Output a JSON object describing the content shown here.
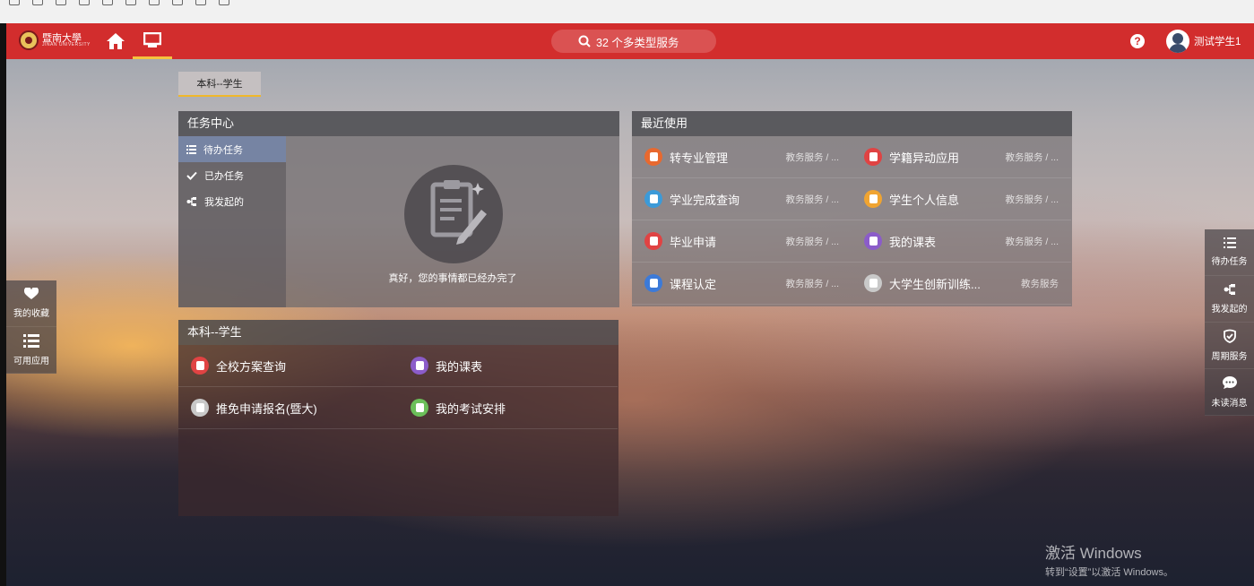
{
  "browser": {
    "bookmarks": [
      "",
      "",
      "",
      "",
      "",
      "",
      "",
      "",
      "",
      "",
      "",
      "",
      ""
    ]
  },
  "header": {
    "logo_cn": "暨南大學",
    "logo_en": "JINAN UNIVERSITY",
    "search_label": "32 个多类型服务",
    "help_label": "?",
    "username": "测试学生1"
  },
  "role_tab": {
    "label": "本科--学生"
  },
  "task_center": {
    "title": "任务中心",
    "tabs": [
      {
        "label": "待办任务",
        "icon": "list-icon"
      },
      {
        "label": "已办任务",
        "icon": "check-icon"
      },
      {
        "label": "我发起的",
        "icon": "share-icon"
      }
    ],
    "empty_message": "真好，您的事情都已经办完了"
  },
  "recent": {
    "title": "最近使用",
    "items": [
      {
        "name": "转专业管理",
        "category": "教务服务 / ...",
        "color": "#e8692f"
      },
      {
        "name": "学籍异动应用",
        "category": "教务服务 / ...",
        "color": "#e04343"
      },
      {
        "name": "学业完成查询",
        "category": "教务服务 / ...",
        "color": "#3c9ad8"
      },
      {
        "name": "学生个人信息",
        "category": "教务服务 / ...",
        "color": "#f0a431"
      },
      {
        "name": "毕业申请",
        "category": "教务服务 / ...",
        "color": "#e04343"
      },
      {
        "name": "我的课表",
        "category": "教务服务 / ...",
        "color": "#8b5cc9"
      },
      {
        "name": "课程认定",
        "category": "教务服务 / ...",
        "color": "#3c7ad8"
      },
      {
        "name": "大学生创新训练...",
        "category": "教务服务",
        "color": "#c9c9c9"
      }
    ]
  },
  "role_panel": {
    "title": "本科--学生",
    "items": [
      {
        "name": "全校方案查询",
        "color": "#e04343"
      },
      {
        "name": "我的课表",
        "color": "#8b5cc9"
      },
      {
        "name": "推免申请报名(暨大)",
        "color": "#c9c9c9"
      },
      {
        "name": "我的考试安排",
        "color": "#6bbf59"
      }
    ]
  },
  "left_dock": {
    "items": [
      {
        "label": "我的收藏",
        "icon": "heart-icon"
      },
      {
        "label": "可用应用",
        "icon": "list-icon"
      }
    ]
  },
  "right_dock": {
    "items": [
      {
        "label": "待办任务",
        "icon": "list-icon"
      },
      {
        "label": "我发起的",
        "icon": "share-icon"
      },
      {
        "label": "周期服务",
        "icon": "shield-check-icon"
      },
      {
        "label": "未读消息",
        "icon": "chat-icon"
      }
    ]
  },
  "watermark": {
    "line1": "激活 Windows",
    "line2": "转到“设置”以激活 Windows。"
  }
}
